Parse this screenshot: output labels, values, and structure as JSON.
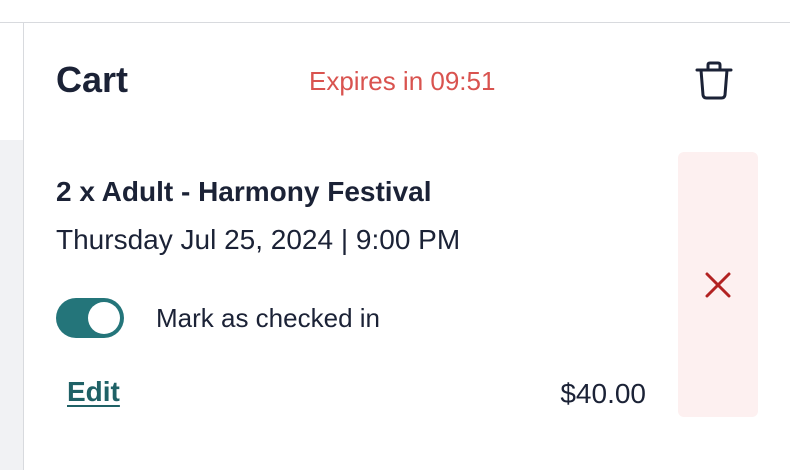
{
  "cart": {
    "title": "Cart",
    "expires_text": "Expires in 09:51",
    "clear_icon": "trash-icon"
  },
  "item": {
    "title": "2 x Adult - Harmony Festival",
    "datetime": "Thursday Jul 25, 2024 | 9:00 PM",
    "checked_in_label": "Mark as checked in",
    "checked_in": true,
    "edit_label": "Edit",
    "price": "$40.00",
    "remove_icon": "close-icon"
  },
  "colors": {
    "accent": "#24757a",
    "expires": "#d9534f",
    "remove": "#b22222",
    "remove_bg": "#fdf0f0"
  }
}
